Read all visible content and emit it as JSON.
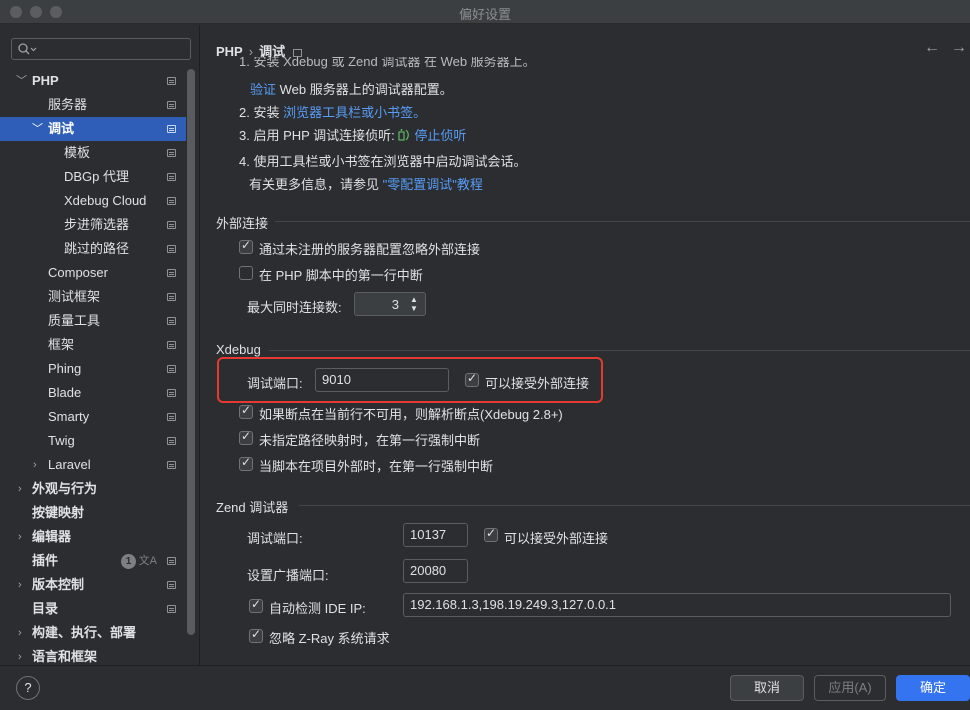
{
  "window": {
    "title": "偏好设置"
  },
  "search": {
    "placeholder": "Q·",
    "icon": "search-icon"
  },
  "sidebar": {
    "items": [
      {
        "label": "PHP",
        "expanded": true,
        "bold": true
      },
      {
        "label": "服务器"
      },
      {
        "label": "调试",
        "expanded": true,
        "selected": true
      },
      {
        "label": "模板"
      },
      {
        "label": "DBGp 代理"
      },
      {
        "label": "Xdebug Cloud"
      },
      {
        "label": "步进筛选器"
      },
      {
        "label": "跳过的路径"
      },
      {
        "label": "Composer"
      },
      {
        "label": "测试框架"
      },
      {
        "label": "质量工具"
      },
      {
        "label": "框架"
      },
      {
        "label": "Phing"
      },
      {
        "label": "Blade"
      },
      {
        "label": "Smarty"
      },
      {
        "label": "Twig"
      },
      {
        "label": "Laravel",
        "expanded": false
      },
      {
        "label": "外观与行为",
        "expanded": false,
        "bold": true
      },
      {
        "label": "按键映射",
        "bold": true
      },
      {
        "label": "编辑器",
        "expanded": false,
        "bold": true
      },
      {
        "label": "插件",
        "bold": true,
        "badge": "1"
      },
      {
        "label": "版本控制",
        "expanded": false,
        "bold": true
      },
      {
        "label": "目录",
        "bold": true
      },
      {
        "label": "构建、执行、部署",
        "expanded": false,
        "bold": true
      },
      {
        "label": "语言和框架",
        "expanded": false,
        "bold": true
      }
    ]
  },
  "breadcrumb": {
    "parent": "PHP",
    "sep": "›",
    "current": "调试"
  },
  "nav": {
    "back": "←",
    "forward": "→"
  },
  "steps": {
    "line1": "1. 安装 Xdebug 或 Zend 调试器 在 Web 服务器上。",
    "line1_link": "验证",
    "line1_cont": " Web 服务器上的调试器配置。",
    "line2_prefix": "2. 安装 ",
    "line2_link": "浏览器工具栏或小书签。",
    "line3_prefix": "3. 启用 PHP 调试连接侦听: ",
    "line3_link": "停止侦听",
    "line4": "4. 使用工具栏或小书签在浏览器中启动调试会话。",
    "more_prefix": "有关更多信息，请参见 ",
    "more_link": "\"零配置调试\"教程"
  },
  "external": {
    "title": "外部连接",
    "ignore_unregistered": {
      "label": "通过未注册的服务器配置忽略外部连接",
      "checked": true
    },
    "break_first_line": {
      "label": "在 PHP 脚本中的第一行中断",
      "checked": false
    },
    "max_conn_label": "最大同时连接数:",
    "max_conn_value": "3"
  },
  "xdebug": {
    "title": "Xdebug",
    "port_label": "调试端口:",
    "port_value": "9010",
    "accept_external": {
      "label": "可以接受外部连接",
      "checked": true
    },
    "opt1": {
      "label": "如果断点在当前行不可用，则解析断点(Xdebug 2.8+)",
      "checked": true
    },
    "opt2": {
      "label": "未指定路径映射时，在第一行强制中断",
      "checked": true
    },
    "opt3": {
      "label": "当脚本在项目外部时，在第一行强制中断",
      "checked": true
    }
  },
  "zend": {
    "title": "Zend 调试器",
    "port_label": "调试端口:",
    "port_value": "10137",
    "accept_external": {
      "label": "可以接受外部连接",
      "checked": true
    },
    "broadcast_label": "设置广播端口:",
    "broadcast_value": "20080",
    "auto_ide": {
      "label": "自动检测 IDE IP:",
      "checked": true
    },
    "ide_ip_value": "192.168.1.3,198.19.249.3,127.0.0.1",
    "ignore_zray": {
      "label": "忽略 Z-Ray 系统请求",
      "checked": true
    }
  },
  "footer": {
    "help": "?",
    "cancel": "取消",
    "apply": "应用(A)",
    "ok": "确定"
  },
  "colors": {
    "accent": "#3574f0",
    "selection": "#2e5eb8",
    "link": "#589df6",
    "highlight": "#e33b30"
  }
}
